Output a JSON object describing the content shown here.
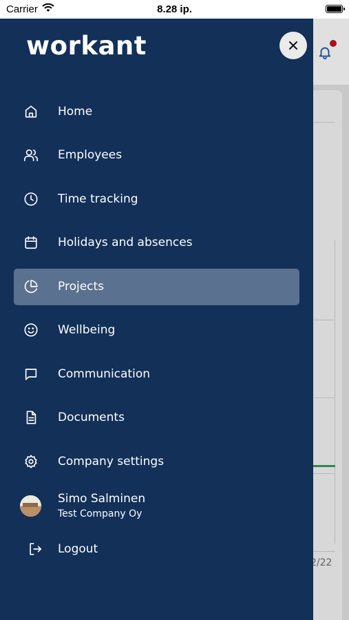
{
  "status_bar": {
    "carrier": "Carrier",
    "time": "8.28 ip."
  },
  "drawer": {
    "logo": "workant",
    "nav": [
      {
        "label": "Home",
        "icon": "home-icon"
      },
      {
        "label": "Employees",
        "icon": "users-icon"
      },
      {
        "label": "Time tracking",
        "icon": "clock-icon"
      },
      {
        "label": "Holidays and absences",
        "icon": "calendar-icon"
      },
      {
        "label": "Projects",
        "icon": "pie-chart-icon",
        "active": true
      },
      {
        "label": "Wellbeing",
        "icon": "smile-icon"
      },
      {
        "label": "Communication",
        "icon": "chat-icon"
      },
      {
        "label": "Documents",
        "icon": "document-icon"
      },
      {
        "label": "Company settings",
        "icon": "gear-icon"
      }
    ],
    "profile": {
      "name": "Simo Salminen",
      "company": "Test Company Oy"
    },
    "logout": {
      "label": "Logout",
      "icon": "logout-icon"
    }
  },
  "background_app": {
    "date_fragment": "2/22"
  },
  "colors": {
    "drawer_bg": "#123058",
    "active_item_bg": "#5a7190",
    "notification_dot": "#c0141e",
    "text": "#ffffff"
  }
}
